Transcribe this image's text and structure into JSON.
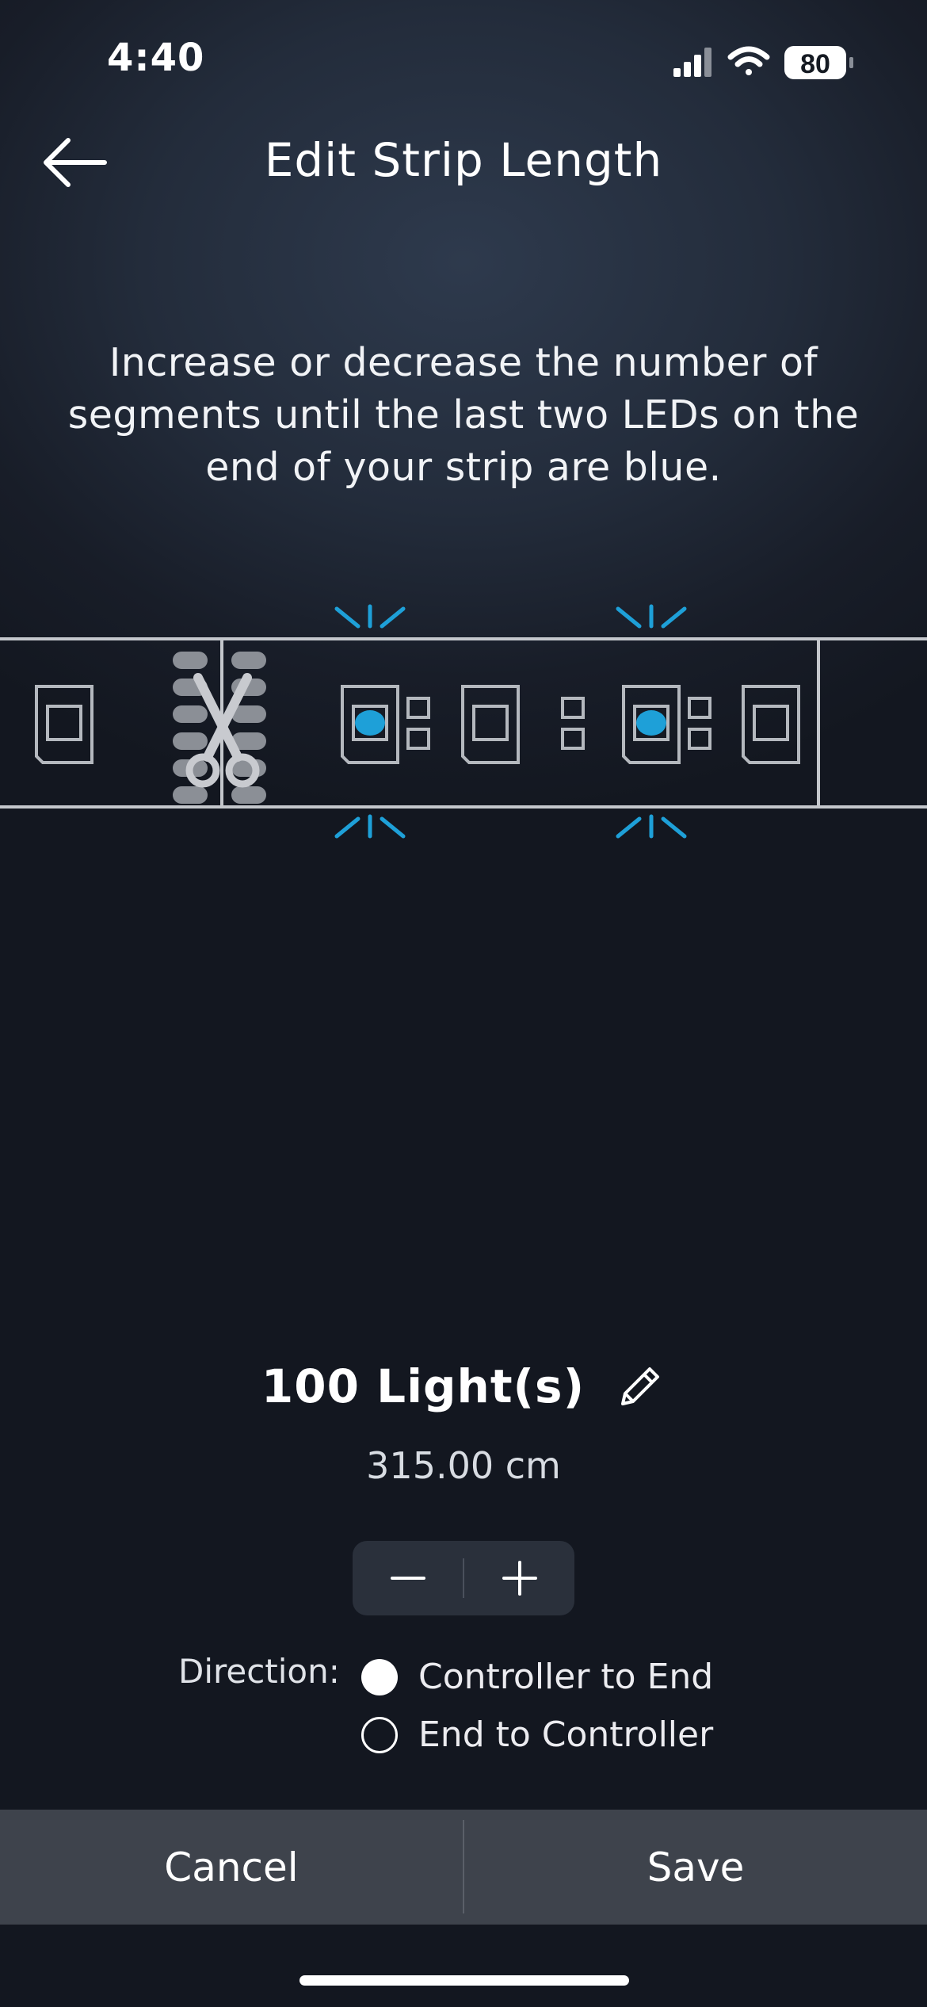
{
  "status_bar": {
    "time": "4:40",
    "battery": "80",
    "icons": [
      "signal-icon",
      "wifi-icon",
      "battery-icon"
    ]
  },
  "nav": {
    "title": "Edit Strip Length",
    "back_icon": "arrow-left-icon"
  },
  "instructions": "Increase or decrease the number of segments until the last two LEDs on the end of your strip are blue.",
  "strip": {
    "led_highlight_color": "#1ea0d8",
    "icons": [
      "scissors-icon",
      "led-chip-icon"
    ]
  },
  "lights": {
    "count_label": "100 Light(s)",
    "length_label": "315.00 cm",
    "edit_icon": "pencil-icon"
  },
  "stepper": {
    "decrement_icon": "minus-icon",
    "increment_icon": "plus-icon"
  },
  "direction": {
    "label": "Direction:",
    "options": [
      {
        "label": "Controller to End",
        "selected": true
      },
      {
        "label": "End to Controller",
        "selected": false
      }
    ]
  },
  "actions": {
    "cancel": "Cancel",
    "save": "Save"
  }
}
